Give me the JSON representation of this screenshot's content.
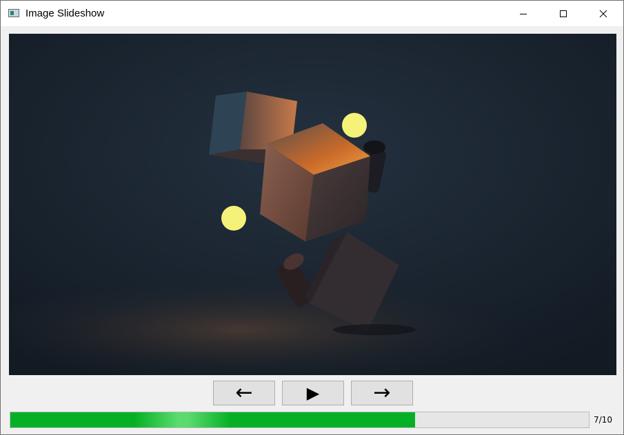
{
  "window": {
    "title": "Image Slideshow",
    "icon": "app-window-icon",
    "controls": {
      "minimize": "minimize-icon",
      "maximize": "maximize-icon",
      "close": "close-icon"
    }
  },
  "viewer": {
    "content": "floating-cubes-image"
  },
  "navigation": {
    "prev_label": "←",
    "play_label": "▶",
    "next_label": "→"
  },
  "progress": {
    "fraction": 0.7,
    "color": "#06b025",
    "counter_text": "7/10"
  }
}
